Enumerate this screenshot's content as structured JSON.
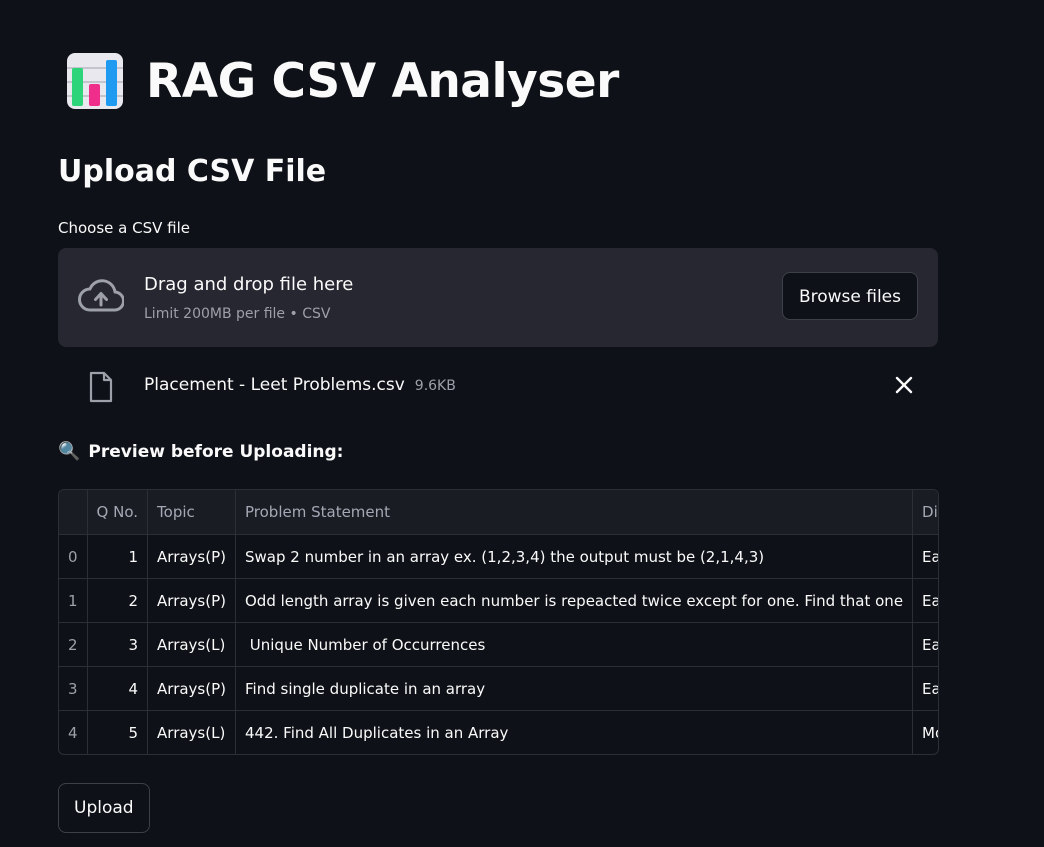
{
  "app": {
    "title": "RAG CSV Analyser",
    "icon": "bar-chart-icon"
  },
  "upload_section": {
    "title": "Upload CSV File",
    "field_label": "Choose a CSV file",
    "dropzone": {
      "main_text": "Drag and drop file here",
      "sub_text": "Limit 200MB per file • CSV",
      "browse_label": "Browse files",
      "icon": "cloud-upload-icon"
    },
    "file": {
      "name": "Placement - Leet Problems.csv",
      "size": "9.6KB",
      "icon": "file-icon"
    }
  },
  "preview": {
    "heading": "Preview before Uploading:",
    "icon": "magnifier-icon",
    "columns": [
      "",
      "Q No.",
      "Topic",
      "Problem Statement",
      "Diffi"
    ],
    "rows": [
      {
        "index": "0",
        "qno": "1",
        "topic": "Arrays(P)",
        "statement": "Swap 2 number in an array ex. (1,2,3,4) the output must be (2,1,4,3)",
        "difficulty": "Easy"
      },
      {
        "index": "1",
        "qno": "2",
        "topic": "Arrays(P)",
        "statement": "Odd length array is given each number is repeacted twice except for one. Find that one",
        "difficulty": "Easy"
      },
      {
        "index": "2",
        "qno": "3",
        "topic": "Arrays(L)",
        "statement": " Unique Number of Occurrences",
        "difficulty": "Easy"
      },
      {
        "index": "3",
        "qno": "4",
        "topic": "Arrays(P)",
        "statement": "Find single duplicate in an array",
        "difficulty": "Easy"
      },
      {
        "index": "4",
        "qno": "5",
        "topic": "Arrays(L)",
        "statement": "442. Find All Duplicates in an Array",
        "difficulty": "Moderate"
      }
    ]
  },
  "actions": {
    "upload_label": "Upload"
  },
  "colors": {
    "background": "#0e1117",
    "surface": "#262730",
    "text": "#fafafa",
    "muted": "#9da0a8"
  }
}
